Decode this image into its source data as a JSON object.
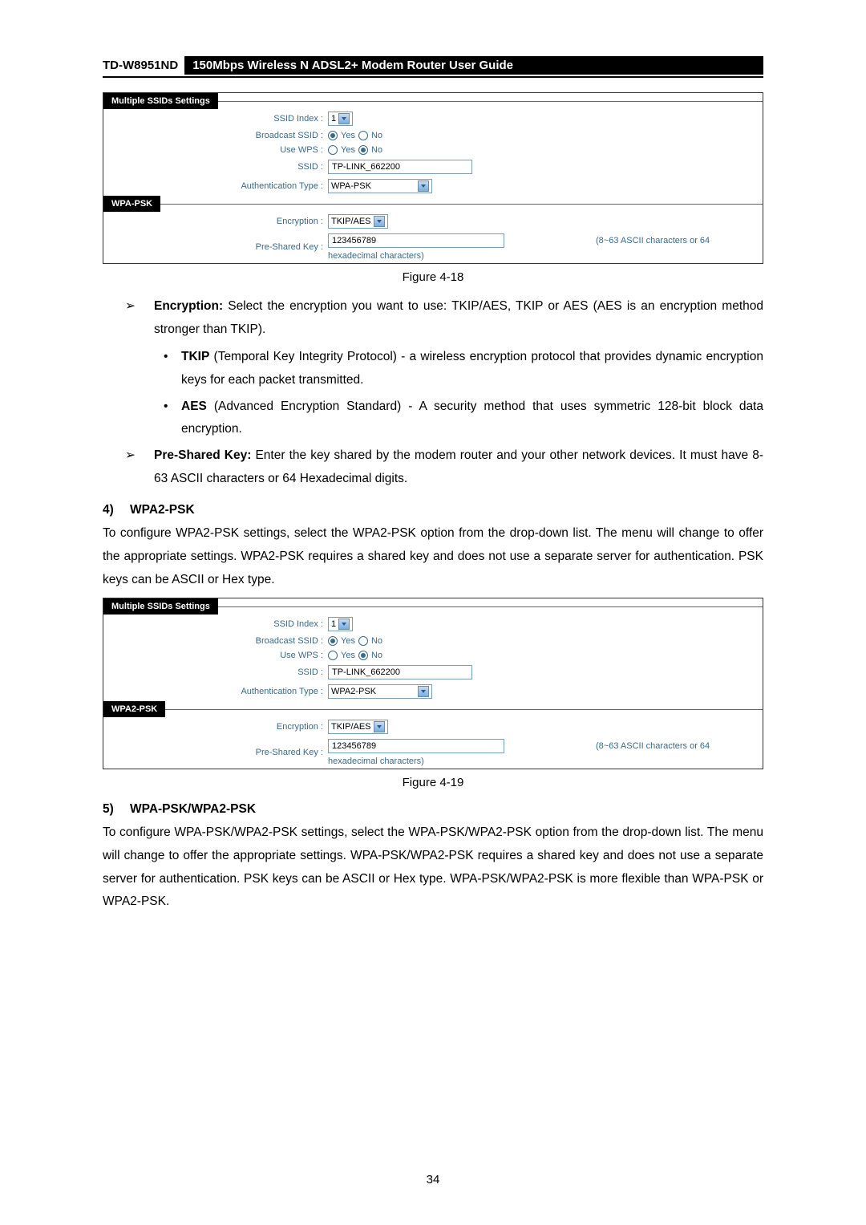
{
  "header": {
    "model": "TD-W8951ND",
    "title": "150Mbps Wireless N ADSL2+ Modem Router User Guide"
  },
  "figure1": {
    "section_header": "Multiple SSIDs Settings",
    "rows": {
      "ssid_index_label": "SSID Index :",
      "ssid_index_value": "1",
      "broadcast_label": "Broadcast SSID :",
      "broadcast_yes": "Yes",
      "broadcast_no": "No",
      "use_wps_label": "Use WPS :",
      "use_wps_yes": "Yes",
      "use_wps_no": "No",
      "ssid_label": "SSID :",
      "ssid_value": "TP-LINK_662200",
      "auth_label": "Authentication Type :",
      "auth_value": "WPA-PSK"
    },
    "wpa_header": "WPA-PSK",
    "wpa_rows": {
      "encryption_label": "Encryption :",
      "encryption_value": "TKIP/AES",
      "key_label": "Pre-Shared Key :",
      "key_value": "123456789",
      "key_note_line1": "(8~63 ASCII characters or 64",
      "key_note_line2": "hexadecimal characters)"
    },
    "caption": "Figure 4-18"
  },
  "text1": {
    "encryption_bold": "Encryption:",
    "encryption_rest": " Select the encryption you want to use: TKIP/AES, TKIP or AES (AES is an encryption method stronger than TKIP).",
    "tkip_full": " (Temporal Key Integrity Protocol) - a wireless encryption protocol that provides dynamic encryption keys for each packet transmitted.",
    "aes_full": " (Advanced Encryption Standard) - A security method that uses symmetric 128-bit block data encryption.",
    "psk_bold": "Pre-Shared Key:",
    "psk_rest": " Enter the key shared by the modem router and your other network devices. It must have 8-63 ASCII characters or 64 Hexadecimal digits."
  },
  "heading4": {
    "num": "4)",
    "text": "WPA2-PSK"
  },
  "para2": "To configure WPA2-PSK settings, select the WPA2-PSK option from the drop-down list. The menu will change to offer the appropriate settings. WPA2-PSK requires a shared key and does not use a separate server for authentication. PSK keys can be ASCII or Hex type.",
  "figure2": {
    "section_header": "Multiple SSIDs Settings",
    "rows": {
      "ssid_index_label": "SSID Index :",
      "ssid_index_value": "1",
      "broadcast_label": "Broadcast SSID :",
      "broadcast_yes": "Yes",
      "broadcast_no": "No",
      "use_wps_label": "Use WPS :",
      "use_wps_yes": "Yes",
      "use_wps_no": "No",
      "ssid_label": "SSID :",
      "ssid_value": "TP-LINK_662200",
      "auth_label": "Authentication Type :",
      "auth_value": "WPA2-PSK"
    },
    "wpa_header": "WPA2-PSK",
    "wpa_rows": {
      "encryption_label": "Encryption :",
      "encryption_value": "TKIP/AES",
      "key_label": "Pre-Shared Key :",
      "key_value": "123456789",
      "key_note_line1": "(8~63 ASCII characters or 64",
      "key_note_line2": "hexadecimal characters)"
    },
    "caption": "Figure 4-19"
  },
  "heading5": {
    "num": "5)",
    "text": "WPA-PSK/WPA2-PSK"
  },
  "para3": "To configure WPA-PSK/WPA2-PSK settings, select the WPA-PSK/WPA2-PSK option from the drop-down list. The menu will change to offer the appropriate settings. WPA-PSK/WPA2-PSK requires a shared key and does not use a separate server for authentication. PSK keys can be ASCII or Hex type. WPA-PSK/WPA2-PSK is more flexible than WPA-PSK or WPA2-PSK.",
  "page_number": "34"
}
